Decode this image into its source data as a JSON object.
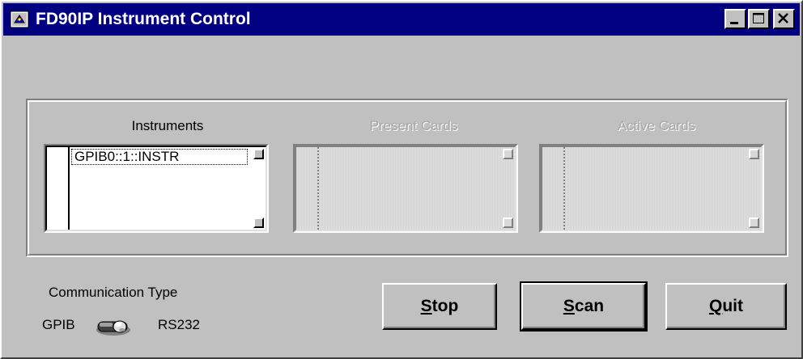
{
  "window": {
    "title": "FD90IP Instrument Control"
  },
  "lists": {
    "instruments": {
      "label": "Instruments",
      "items": [
        "GPIB0::1::INSTR"
      ]
    },
    "present_cards": {
      "label": "Present Cards",
      "items": []
    },
    "active_cards": {
      "label": "Active Cards",
      "items": []
    }
  },
  "communication": {
    "label": "Communication Type",
    "left_option": "GPIB",
    "right_option": "RS232",
    "selected": "GPIB"
  },
  "buttons": {
    "stop": {
      "mnemonic": "S",
      "rest": "top"
    },
    "scan": {
      "mnemonic": "S",
      "rest": "can"
    },
    "quit": {
      "mnemonic": "Q",
      "rest": "uit"
    }
  },
  "icons": {
    "app": "labview-vi-icon",
    "minimize": "minimize-icon",
    "maximize": "maximize-icon",
    "close": "close-icon",
    "toggle": "toggle-switch-icon"
  }
}
